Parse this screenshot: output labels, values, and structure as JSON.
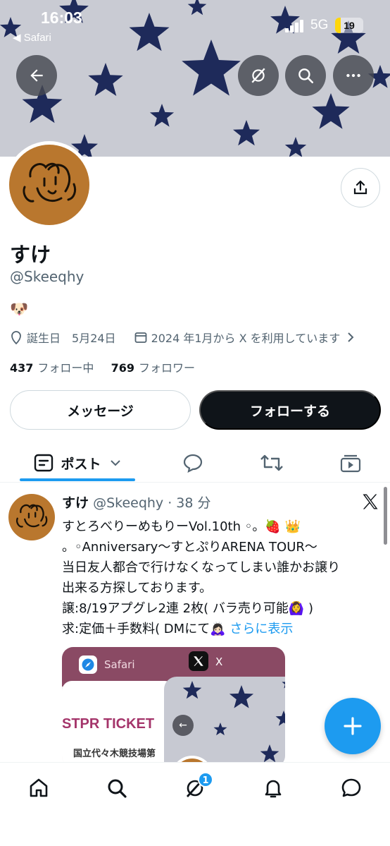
{
  "status_bar": {
    "time": "16:03",
    "back_app": "◀ Safari",
    "network": "5G",
    "battery": "19",
    "battery_level": 0.19
  },
  "header_buttons": {
    "back_icon": "arrow-left-icon",
    "grok_icon": "grok-icon",
    "search_icon": "search-icon",
    "more_icon": "more-icon"
  },
  "profile": {
    "display_name": "すけ",
    "handle": "@Skeeqhy",
    "bio": "🐶",
    "birthday_label": "誕生日",
    "birthday_value": "5月24日",
    "joined": "2024 年1月から X を利用しています",
    "following_count": "437",
    "following_label": "フォロー中",
    "followers_count": "769",
    "followers_label": "フォロワー"
  },
  "actions": {
    "message": "メッセージ",
    "follow": "フォローする"
  },
  "tabs": {
    "posts_label": "ポスト"
  },
  "post": {
    "name": "すけ",
    "meta": "@Skeeqhy · 38 分",
    "lines": [
      "すとろべりーめもりーVol.10th ◦。🍓 👑",
      "。◦Anniversary〜すとぷりARENA TOUR〜",
      "当日友人都合で行けなくなってしまい誰かお譲り",
      "出来る方探しております。",
      "譲:8/19アプグレ2連 2枚( バラ売り可能🙆‍♀️ )"
    ],
    "last_line": "求:定価＋手数料( DMにて🙇🏻‍♀️ ",
    "show_more": "さらに表示"
  },
  "media": {
    "app_label": "Safari",
    "x_label": "X",
    "ticket_title": "STPR TICKET",
    "venue": "国立代々木競技場第"
  },
  "bottom_nav": {
    "badge": "1"
  },
  "colors": {
    "accent": "#1d9bf0",
    "text": "#0f1419",
    "secondary": "#536471",
    "star": "#1e2a5a"
  }
}
